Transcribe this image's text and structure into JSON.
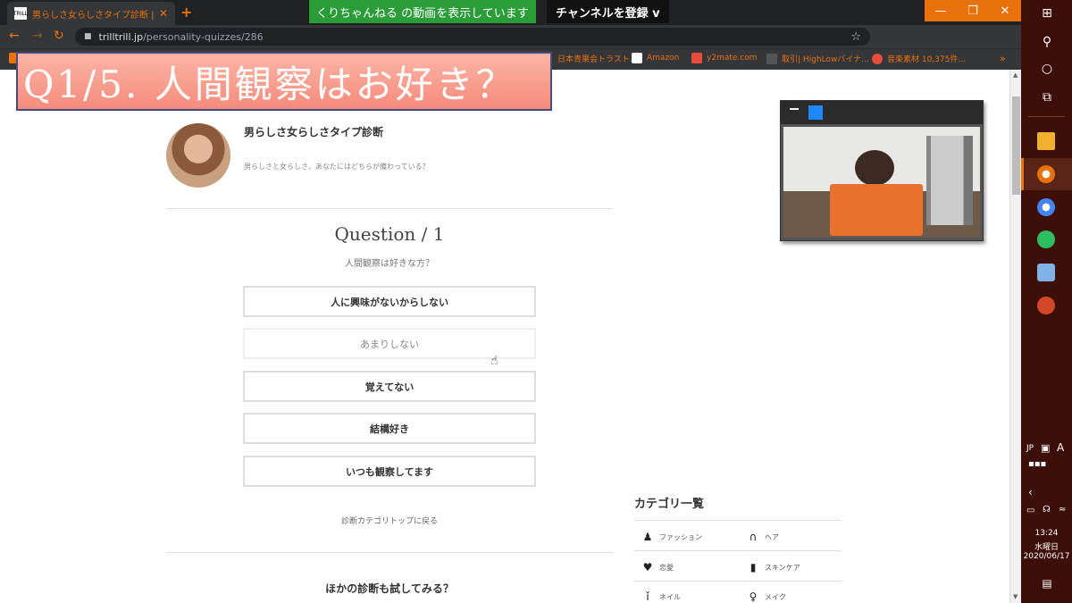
{
  "browser": {
    "tab_title": "男らしさ女らしさタイプ診断 | TRILL(",
    "favicon_text": "TRILL",
    "tab_close": "✕",
    "new_tab": "+",
    "url_host": "trilltrill.jp",
    "url_path": "/personality-quizzes/286",
    "bookmarks": [
      {
        "label": "日本青果会トラスト...",
        "color": "#c0392b"
      },
      {
        "label": "Amazon",
        "color": "#ffffff"
      },
      {
        "label": "y2mate.com",
        "color": "#e74c3c"
      },
      {
        "label": "取引| HighLowバイナ...",
        "color": "#555"
      },
      {
        "label": "音楽素材 10,375件...",
        "color": "#e74c3c"
      }
    ]
  },
  "youtube": {
    "showing": "くりちゃんねる の動画を表示しています",
    "subscribe": "チャンネルを登録 v"
  },
  "overlay": {
    "question_caption": "Q1/5. 人間観察はお好き？"
  },
  "quiz": {
    "title": "男らしさ女らしさタイプ診断",
    "description": "男らしさと女らしさ。あなたにはどちらが備わっている？",
    "question_heading": "Question / 1",
    "question_text": "人間観察は好きな方？",
    "answers": [
      "人に興味がないからしない",
      "あまりしない",
      "覚えてない",
      "結構好き",
      "いつも観察してます"
    ],
    "back_link": "診断カテゴリトップに戻る",
    "other_heading": "ほかの診断も試してみる？"
  },
  "categories": {
    "title": "カテゴリ一覧",
    "items": [
      {
        "label": "ファッション",
        "icon": "dress-icon",
        "glyph": "♟"
      },
      {
        "label": "ヘア",
        "icon": "hair-icon",
        "glyph": "∩"
      },
      {
        "label": "恋愛",
        "icon": "heart-icon",
        "glyph": "♥"
      },
      {
        "label": "スキンケア",
        "icon": "bottle-icon",
        "glyph": "▮"
      },
      {
        "label": "ネイル",
        "icon": "nail-polish-icon",
        "glyph": "ǐ"
      },
      {
        "label": "メイク",
        "icon": "makeup-icon",
        "glyph": "♀"
      }
    ]
  },
  "taskbar": {
    "lang": "JP",
    "ime": "A",
    "time": "13:24",
    "weekday": "水曜日",
    "date": "2020/06/17"
  }
}
